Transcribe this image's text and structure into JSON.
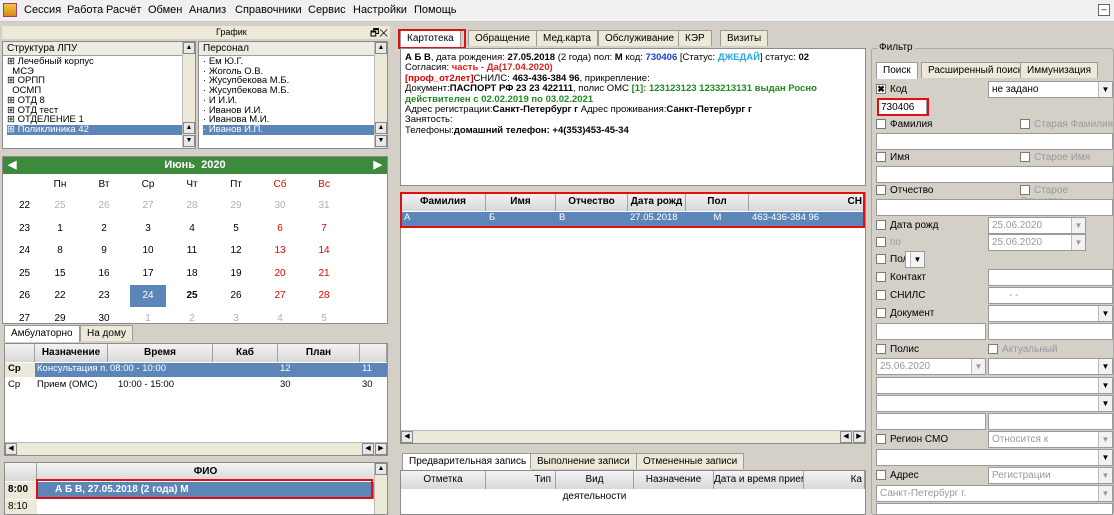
{
  "menu": [
    "Сессия",
    "Работа",
    "Расчёт",
    "Обмен",
    "Анализ",
    "Справочники",
    "Сервис",
    "Настройки",
    "Помощь"
  ],
  "schedule_label": "График",
  "structure": {
    "header": "Структура ЛПУ",
    "items": [
      "Лечебный корпус",
      "МСЭ",
      "ОРПП",
      "ОСМП",
      "ОТД 8",
      "ОТД тест",
      "ОТДЕЛЕНИЕ 1",
      "Поликлиника 42"
    ]
  },
  "personnel": {
    "header": "Персонал",
    "items": [
      "Ем Ю.Г.",
      "Жоголь О.В.",
      "Жусупбекова М.Б.",
      "Жусупбекова М.Б.",
      "И И.И.",
      "Иванов И.И.",
      "Иванова М.И.",
      "Иванов И.П."
    ]
  },
  "calendar": {
    "month": "Июнь",
    "year": "2020",
    "weekdays": [
      "Пн",
      "Вт",
      "Ср",
      "Чт",
      "Пт",
      "Сб",
      "Вс"
    ],
    "weeks": [
      {
        "num": "22",
        "days": [
          "25",
          "26",
          "27",
          "28",
          "29",
          "30",
          "31"
        ]
      },
      {
        "num": "23",
        "days": [
          "1",
          "2",
          "3",
          "4",
          "5",
          "6",
          "7"
        ]
      },
      {
        "num": "24",
        "days": [
          "8",
          "9",
          "10",
          "11",
          "12",
          "13",
          "14"
        ]
      },
      {
        "num": "25",
        "days": [
          "15",
          "16",
          "17",
          "18",
          "19",
          "20",
          "21"
        ]
      },
      {
        "num": "26",
        "days": [
          "22",
          "23",
          "24",
          "25",
          "26",
          "27",
          "28"
        ]
      },
      {
        "num": "27",
        "days": [
          "29",
          "30",
          "1",
          "2",
          "3",
          "4",
          "5"
        ]
      }
    ]
  },
  "amb_tabs": [
    "Амбулаторно",
    "На дому"
  ],
  "appointments": {
    "headers": [
      "Назначение",
      "Время",
      "Каб",
      "План"
    ],
    "rows": [
      {
        "day": "Ср",
        "name": "Консультация п...",
        "time": "08:00 - 10:00",
        "cab": "",
        "plan": "12",
        "extra": "11"
      },
      {
        "day": "Ср",
        "name": "Прием (ОМС)",
        "time": "10:00 - 15:00",
        "cab": "",
        "plan": "30",
        "extra": "30"
      }
    ]
  },
  "slots": {
    "header": "ФИО",
    "rows": [
      {
        "time": "8:00",
        "patient": "А Б В, 27.05.2018 (2 года) М"
      },
      {
        "time": "8:10",
        "patient": ""
      }
    ]
  },
  "card_tabs": [
    "Картотека",
    "Обращение",
    "Мед.карта",
    "Обслуживание",
    "КЭР",
    "Визиты"
  ],
  "card": {
    "line1_name": "А Б В",
    "line1_text1": ", дата рождения: ",
    "line1_dob": "27.05.2018",
    "line1_text2": " (2 года) пол: ",
    "line1_sex": "М",
    "line1_text3": " код: ",
    "line1_code": "730406",
    "line1_text4": " [Статус: ",
    "line1_status": "ДЖЕДАЙ",
    "line1_text5": "] статус: ",
    "line1_status2": "02",
    "consent_label": "Согласия: ",
    "consent_value": "часть - Да(17.04.2020)",
    "prof": "[проф_от2лет]",
    "snils_label": "СНИЛС: ",
    "snils": "463-436-384 96",
    "attach": ", прикрепление:",
    "doc_label": "Документ:",
    "doc": "ПАСПОРТ РФ 23 23 422111",
    "polis_label": ", полис ОМС ",
    "polis": "[1]: 123123123 1233213131 выдан Росно",
    "valid": "действителен с 02.02.2019 по 03.02.2021",
    "reg_label": "Адрес регистрации:",
    "reg": "Санкт-Петербург г",
    "live_label": " Адрес проживания:",
    "live": "Санкт-Петербург г",
    "job_label": "Занятость:",
    "phones_label": "Телефоны:",
    "phones": "домашний телефон: +4(353)453-45-34"
  },
  "patients": {
    "headers": [
      "Фамилия",
      "Имя",
      "Отчество",
      "Дата рожд",
      "Пол",
      "СН"
    ],
    "rows": [
      {
        "surname": "А",
        "name": "Б",
        "patronymic": "В",
        "dob": "27.05.2018",
        "sex": "М",
        "snils": "463-436-384 96"
      }
    ]
  },
  "record_tabs": [
    "Предварительная запись",
    "Выполнение записи",
    "Отмененные записи"
  ],
  "record_headers": [
    "Отметка",
    "Тип",
    "Вид деятельности",
    "Назначение",
    "Дата и время приема",
    "Ка"
  ],
  "filter": {
    "title": "Фильтр",
    "tabs": [
      "Поиск",
      "Расширенный поиск",
      "Иммунизация"
    ],
    "code_label": "Код",
    "code_mode": "не задано",
    "code_value": "730406",
    "surname": "Фамилия",
    "old_surname": "Старая Фамилия",
    "name": "Имя",
    "old_name": "Старое Имя",
    "patronymic": "Отчество",
    "old_patronymic": "Старое Отчество",
    "dob": "Дата рожд",
    "dob_value": "25.06.2020",
    "to": "по",
    "to_value": "25.06.2020",
    "sex": "Пол",
    "contact": "Контакт",
    "snils": "СНИЛС",
    "snils_mask": "- -",
    "document": "Документ",
    "polis": "Полис",
    "actual": "Актуальный",
    "polis_date": "25.06.2020",
    "region": "Регион СМО",
    "region_value": "Относится к",
    "address": "Адрес",
    "address_type": "Регистрации",
    "city": "Санкт-Петербург г."
  }
}
